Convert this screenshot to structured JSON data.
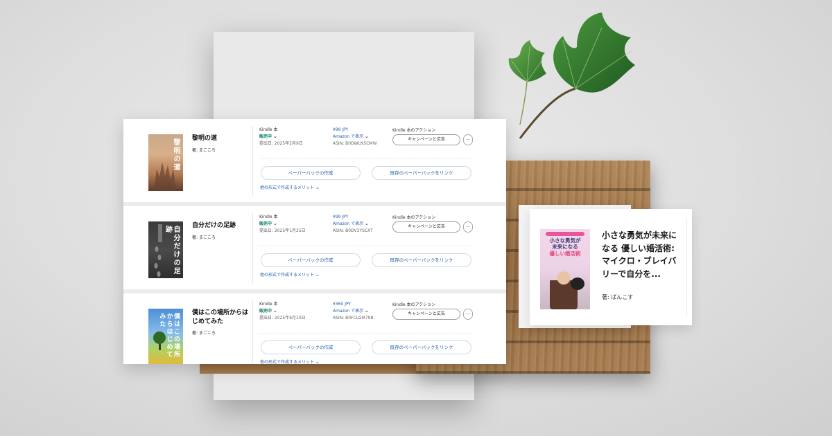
{
  "books": [
    {
      "title": "黎明の道",
      "author": "著: まごころ",
      "cover_text": "黎明の道",
      "format": "Kindle 本",
      "status": "販売中",
      "submitted": "提出日: 2025年2月9日",
      "price": "¥99 JPY",
      "amazon_link": "Amazon で表示",
      "asin": "ASIN: B0DWLN5CMW",
      "actions_label": "Kindle 本のアクション",
      "campaign_button": "キャンペーンと広告",
      "more_button": "…",
      "paperback_create": "ペーパーバックの作成",
      "paperback_link": "既存のペーパーバックをリンク",
      "benefits_link": "他の形式で作成するメリット"
    },
    {
      "title": "自分だけの足跡",
      "author": "著: まごころ",
      "cover_text": "自分だけの足跡",
      "format": "Kindle 本",
      "status": "販売中",
      "submitted": "提出日: 2025年1月25日",
      "price": "¥99 JPY",
      "amazon_link": "Amazon で表示",
      "asin": "ASIN: B0DV3YSCXT",
      "actions_label": "Kindle 本のアクション",
      "campaign_button": "キャンペーンと広告",
      "more_button": "…",
      "paperback_create": "ペーパーバックの作成",
      "paperback_link": "既存のペーパーバックをリンク",
      "benefits_link": "他の形式で作成するメリット"
    },
    {
      "title": "僕はこの場所からはじめてみた",
      "author": "著: まごころ",
      "cover_text": "僕はこの場所からはじめてみた",
      "format": "Kindle 本",
      "status": "販売中",
      "submitted": "提出日: 2025年6月10日",
      "price": "¥360 JPY",
      "amazon_link": "Amazon で表示",
      "asin": "ASIN: B0FCLGM798",
      "actions_label": "Kindle 本のアクション",
      "campaign_button": "キャンペーンと広告",
      "more_button": "…",
      "paperback_create": "ペーパーバックの作成",
      "paperback_link": "既存のペーパーバックをリンク",
      "benefits_link": "他の形式で作成するメリット"
    }
  ],
  "featured": {
    "title": "小さな勇気が未来になる 優しい婚活術: マイクロ・ブレイバリーで自分を...",
    "author": "著: ぱんこす",
    "cover_title_line1": "小さな勇気が",
    "cover_title_line2": "未来になる",
    "cover_title_line3": "優しい婚活術"
  },
  "colors": {
    "status_green": "#067d62",
    "link_blue": "#1f5fa8",
    "leaf_green": "#2f7a2f",
    "wood": "#9a6e44"
  },
  "icons": {
    "chevron": "chevron-down-icon",
    "leaf": "ivy-leaf-icon"
  }
}
